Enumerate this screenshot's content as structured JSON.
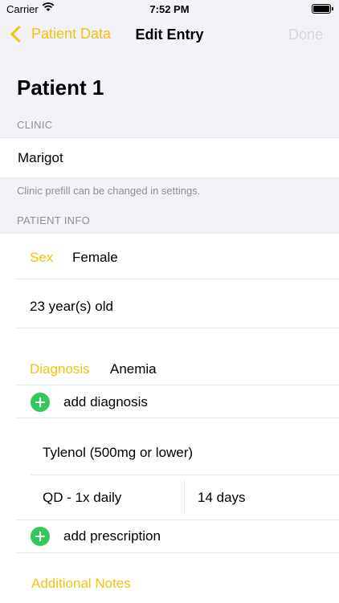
{
  "status": {
    "carrier": "Carrier",
    "time": "7:52 PM"
  },
  "nav": {
    "back_label": "Patient Data",
    "title": "Edit Entry",
    "done_label": "Done"
  },
  "patient_name": "Patient 1",
  "clinic": {
    "header": "CLINIC",
    "value": "Marigot",
    "note": "Clinic prefill can be changed in settings."
  },
  "patient_info": {
    "header": "PATIENT INFO",
    "sex_label": "Sex",
    "sex_value": "Female",
    "age": "23 year(s) old",
    "diagnosis_label": "Diagnosis",
    "diagnosis_value": "Anemia",
    "add_diagnosis": "add diagnosis",
    "prescription": {
      "drug": "Tylenol (500mg or lower)",
      "frequency": "QD - 1x daily",
      "duration": "14 days"
    },
    "add_prescription": "add prescription",
    "notes_label": "Additional Notes"
  },
  "colors": {
    "accent": "#f4c20d",
    "add": "#34c759",
    "secondary": "#8e8e93",
    "background": "#f2f2f7"
  }
}
